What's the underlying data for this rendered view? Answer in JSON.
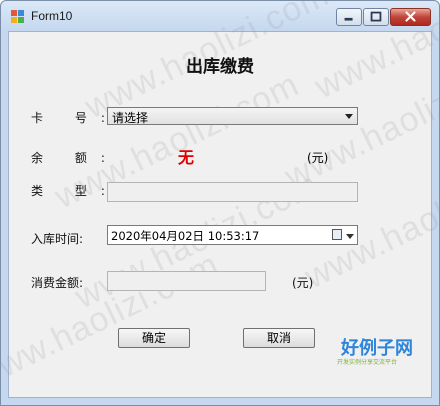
{
  "window": {
    "title": "Form10"
  },
  "form": {
    "heading": "出库缴费",
    "card_label": "卡 号:",
    "card_select": {
      "selected": "请选择"
    },
    "balance_label": "余 额:",
    "balance_value": "无",
    "balance_unit": "(元)",
    "type_label": "类 型:",
    "type_value": "",
    "time_label": "入库时间:",
    "time_value": "2020年04月02日  10:53:17",
    "amount_label": "消费金额:",
    "amount_value": "",
    "amount_unit": "(元)",
    "confirm_label": "确定",
    "cancel_label": "取消"
  },
  "watermark": {
    "text": "www.haolizi.com"
  },
  "logo": {
    "main": "好例子网",
    "sub": "开发实例分享交流平台"
  },
  "colors": {
    "balance": "#e00000",
    "logo": "#2e85d9",
    "logo_sub": "#7fb13b"
  }
}
